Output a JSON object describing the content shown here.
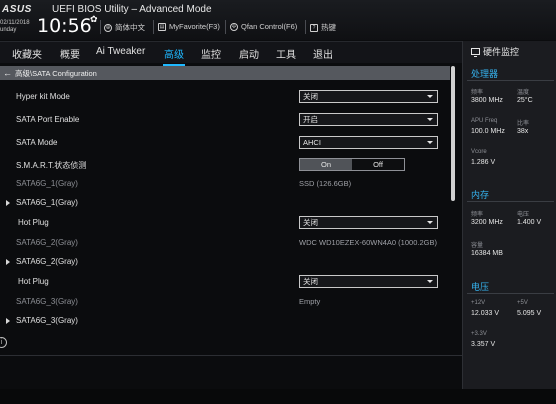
{
  "header": {
    "logo": "ASUS",
    "title": "UEFI BIOS Utility – Advanced Mode",
    "date": "02/11/2018",
    "day": "unday",
    "time": "10:56",
    "language": "简体中文",
    "myfavorite": "MyFavorite(F3)",
    "qfan": "Qfan Control(F6)",
    "hotkeys": "热键"
  },
  "menu": {
    "items": [
      "收藏夹",
      "概要",
      "Ai Tweaker",
      "高级",
      "监控",
      "启动",
      "工具",
      "退出"
    ],
    "active": "高级"
  },
  "breadcrumb": "高级\\SATA Configuration",
  "settings": {
    "hyperkit_label": "Hyper kit Mode",
    "hyperkit_value": "关闭",
    "sataport_label": "SATA Port Enable",
    "sataport_value": "开启",
    "satamode_label": "SATA Mode",
    "satamode_value": "AHCI",
    "smart_label": "S.M.A.R.T.状态侦测",
    "smart_on": "On",
    "smart_off": "Off",
    "port1_label": "SATA6G_1(Gray)",
    "port1_device": "SSD (126.6GB)",
    "port1_expand": "SATA6G_1(Gray)",
    "hotplug1_label": "Hot Plug",
    "hotplug1_value": "关闭",
    "port2_label": "SATA6G_2(Gray)",
    "port2_device": "WDC WD10EZEX-60WN4A0 (1000.2GB)",
    "port2_expand": "SATA6G_2(Gray)",
    "hotplug2_label": "Hot Plug",
    "hotplug2_value": "关闭",
    "port3_label": "SATA6G_3(Gray)",
    "port3_device": "Empty",
    "port3_expand": "SATA6G_3(Gray)"
  },
  "hw_monitor": {
    "title": "硬件监控",
    "cpu": {
      "title": "处理器",
      "freq_label": "频率",
      "freq_value": "3800 MHz",
      "temp_label": "温度",
      "temp_value": "25°C",
      "apu_label": "APU Freq",
      "apu_value": "100.0 MHz",
      "ratio_label": "比率",
      "ratio_value": "38x",
      "vcore_label": "Vcore",
      "vcore_value": "1.286 V"
    },
    "memory": {
      "title": "内存",
      "freq_label": "频率",
      "freq_value": "3200 MHz",
      "volt_label": "电压",
      "volt_value": "1.400 V",
      "cap_label": "容量",
      "cap_value": "16384 MB"
    },
    "voltage": {
      "title": "电压",
      "v12_label": "+12V",
      "v12_value": "12.033 V",
      "v5_label": "+5V",
      "v5_value": "5.095 V",
      "v33_label": "+3.3V",
      "v33_value": "3.357 V"
    }
  },
  "colors": {
    "accent": "#1fb8ff",
    "section": "#35b2ee",
    "breadcrumb_bg": "#55585e"
  },
  "icons": {
    "gear": "gear-icon",
    "globe": "globe-icon",
    "favorite": "favorite-icon",
    "fan": "fan-icon",
    "help": "help-icon",
    "back": "back-arrow-icon",
    "expand": "expand-arrow-icon",
    "monitor": "monitor-icon",
    "info": "info-icon"
  }
}
